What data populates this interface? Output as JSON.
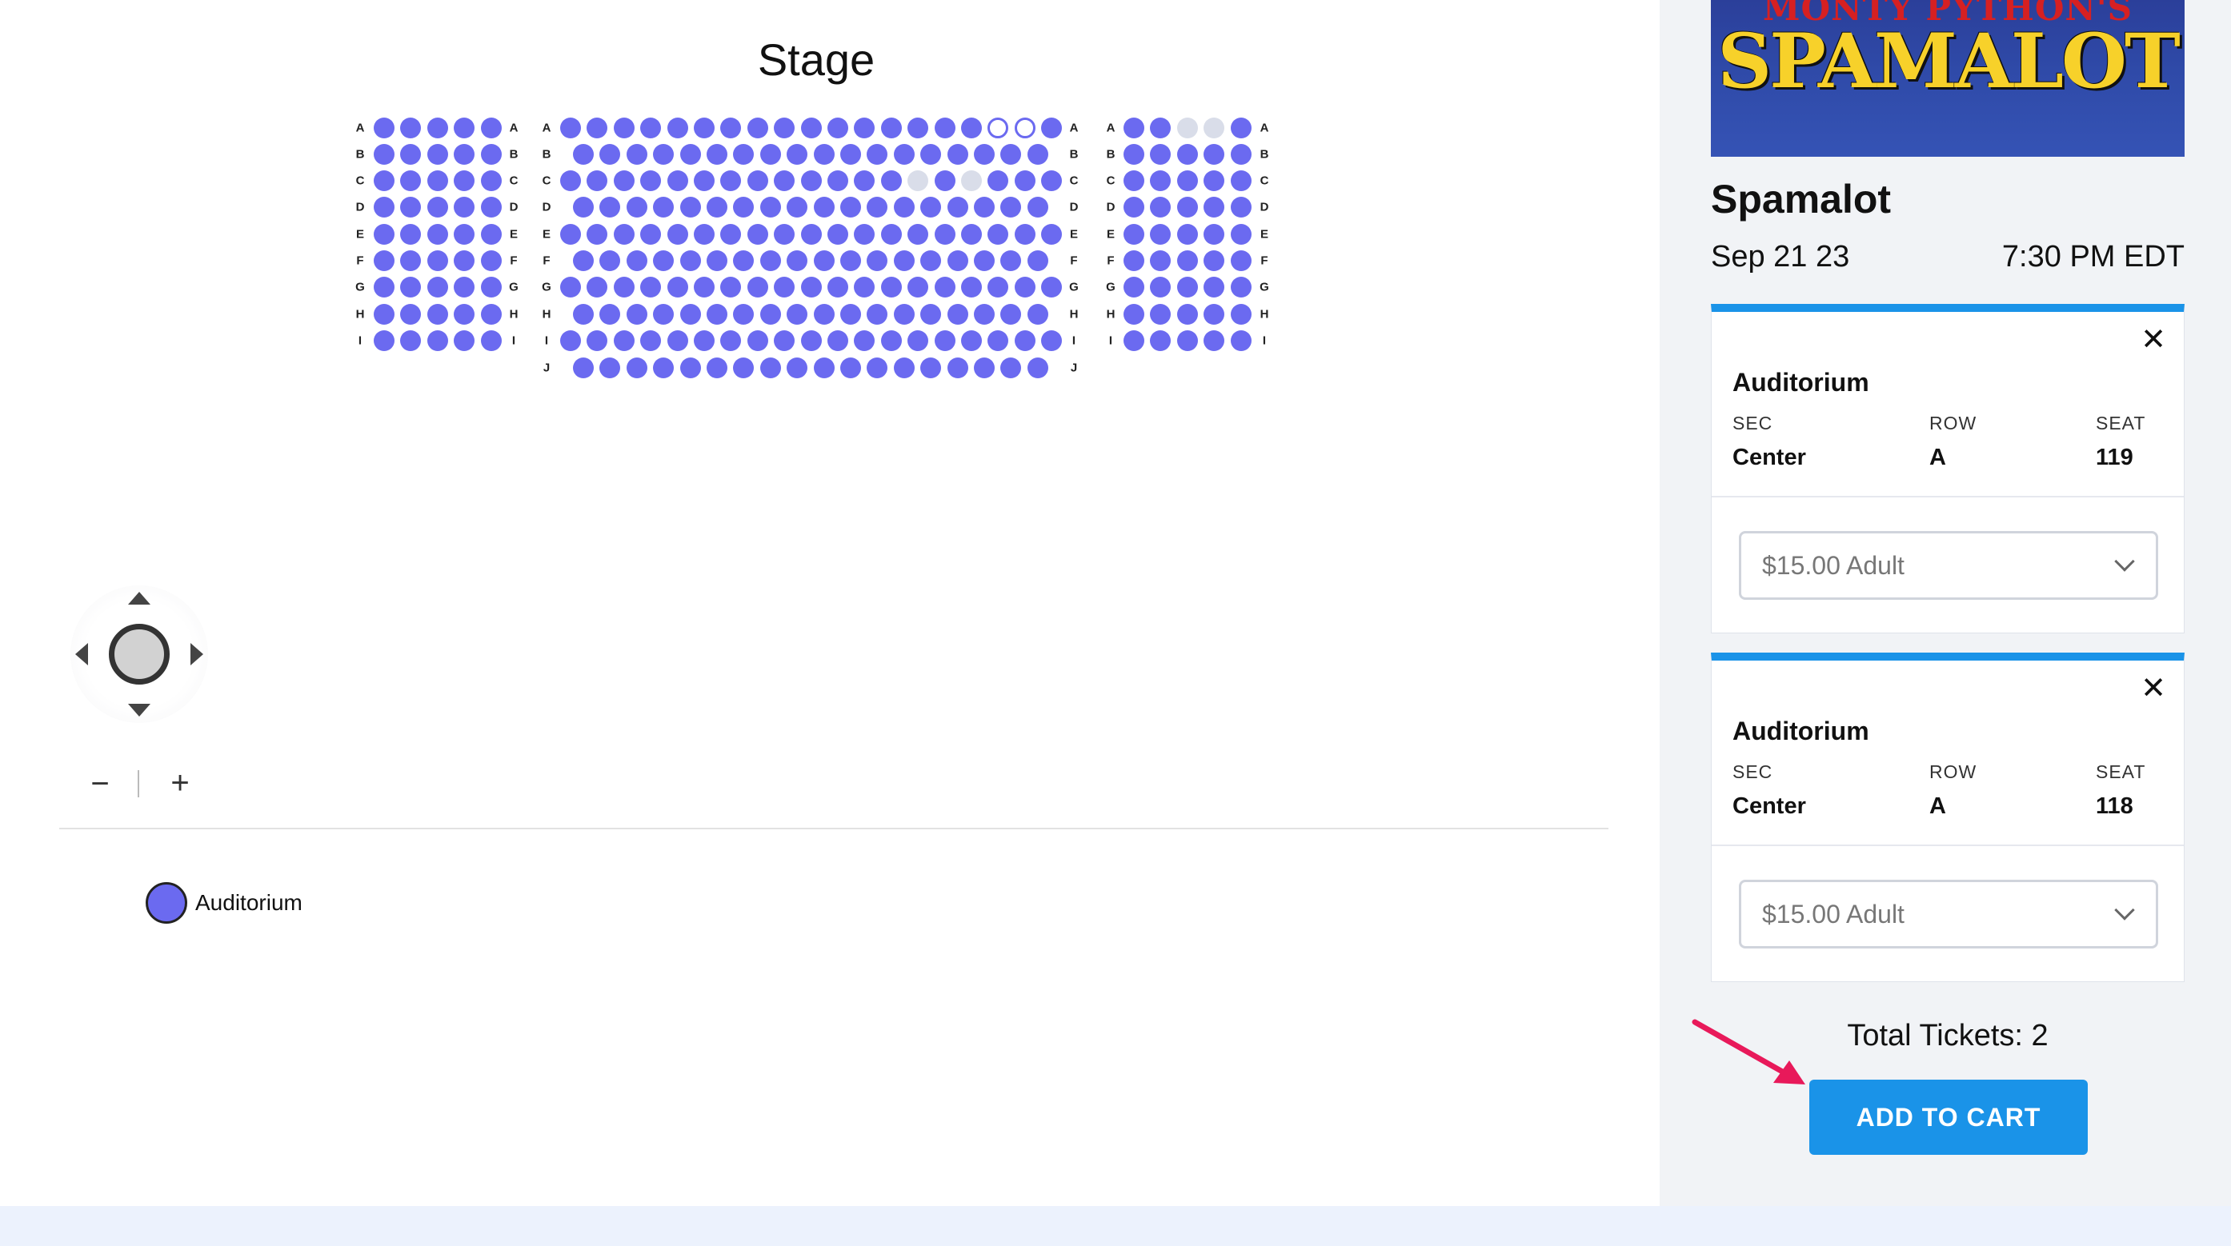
{
  "stage": {
    "label": "Stage"
  },
  "seat_map": {
    "colors": {
      "available": "#6b6af0",
      "unavailable": "#d9dde9",
      "selected_outline": "#6b6af0"
    },
    "sections": [
      {
        "name": "left",
        "rows": [
          {
            "letter": "A",
            "seats": 5,
            "unavailable": [],
            "selected": []
          },
          {
            "letter": "B",
            "seats": 5,
            "unavailable": [],
            "selected": []
          },
          {
            "letter": "C",
            "seats": 5,
            "unavailable": [],
            "selected": []
          },
          {
            "letter": "D",
            "seats": 5,
            "unavailable": [],
            "selected": []
          },
          {
            "letter": "E",
            "seats": 5,
            "unavailable": [],
            "selected": []
          },
          {
            "letter": "F",
            "seats": 5,
            "unavailable": [],
            "selected": []
          },
          {
            "letter": "G",
            "seats": 5,
            "unavailable": [],
            "selected": []
          },
          {
            "letter": "H",
            "seats": 5,
            "unavailable": [],
            "selected": []
          },
          {
            "letter": "I",
            "seats": 5,
            "unavailable": [],
            "selected": []
          }
        ]
      },
      {
        "name": "center",
        "rows": [
          {
            "letter": "A",
            "seats": 19,
            "unavailable": [],
            "selected": [
              17,
              18
            ]
          },
          {
            "letter": "B",
            "seats": 18,
            "unavailable": [],
            "selected": []
          },
          {
            "letter": "C",
            "seats": 19,
            "unavailable": [
              14,
              16
            ],
            "selected": []
          },
          {
            "letter": "D",
            "seats": 18,
            "unavailable": [],
            "selected": []
          },
          {
            "letter": "E",
            "seats": 19,
            "unavailable": [],
            "selected": []
          },
          {
            "letter": "F",
            "seats": 18,
            "unavailable": [],
            "selected": []
          },
          {
            "letter": "G",
            "seats": 19,
            "unavailable": [],
            "selected": []
          },
          {
            "letter": "H",
            "seats": 18,
            "unavailable": [],
            "selected": []
          },
          {
            "letter": "I",
            "seats": 19,
            "unavailable": [],
            "selected": []
          },
          {
            "letter": "J",
            "seats": 18,
            "unavailable": [],
            "selected": []
          }
        ]
      },
      {
        "name": "right",
        "rows": [
          {
            "letter": "A",
            "seats": 5,
            "unavailable": [
              3,
              4
            ],
            "selected": []
          },
          {
            "letter": "B",
            "seats": 5,
            "unavailable": [],
            "selected": []
          },
          {
            "letter": "C",
            "seats": 5,
            "unavailable": [],
            "selected": []
          },
          {
            "letter": "D",
            "seats": 5,
            "unavailable": [],
            "selected": []
          },
          {
            "letter": "E",
            "seats": 5,
            "unavailable": [],
            "selected": []
          },
          {
            "letter": "F",
            "seats": 5,
            "unavailable": [],
            "selected": []
          },
          {
            "letter": "G",
            "seats": 5,
            "unavailable": [],
            "selected": []
          },
          {
            "letter": "H",
            "seats": 5,
            "unavailable": [],
            "selected": []
          },
          {
            "letter": "I",
            "seats": 5,
            "unavailable": [],
            "selected": []
          }
        ]
      }
    ]
  },
  "controls": {
    "zoom_out": "−",
    "zoom_in": "+"
  },
  "legend": {
    "items": [
      {
        "label": "Auditorium",
        "color": "#6b6af0"
      }
    ]
  },
  "event": {
    "poster": {
      "subtitle": "MONTY PYTHON'S",
      "title": "SPAMALOT"
    },
    "title": "Spamalot",
    "date": "Sep 21 23",
    "time": "7:30 PM EDT"
  },
  "tickets": [
    {
      "close": "✕",
      "area": "Auditorium",
      "sec_label": "SEC",
      "row_label": "ROW",
      "seat_label": "SEAT",
      "sec": "Center",
      "row": "A",
      "seat": "119",
      "price_type": "$15.00 Adult"
    },
    {
      "close": "✕",
      "area": "Auditorium",
      "sec_label": "SEC",
      "row_label": "ROW",
      "seat_label": "SEAT",
      "sec": "Center",
      "row": "A",
      "seat": "118",
      "price_type": "$15.00 Adult"
    }
  ],
  "cart": {
    "total_text": "Total Tickets: 2",
    "add_to_cart": "ADD TO CART",
    "button_color": "#1a93e8",
    "annotation_arrow_color": "#e8195a"
  }
}
